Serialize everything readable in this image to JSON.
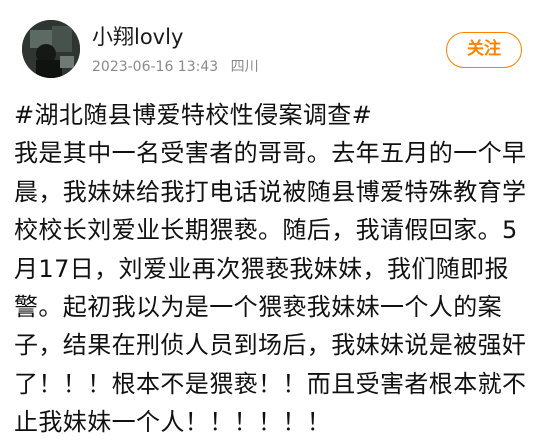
{
  "post": {
    "author": {
      "name": "小翔lovly",
      "timestamp": "2023-06-16 13:43",
      "location": "四川"
    },
    "follow_label": "关注",
    "hashtag": "#湖北随县博爱特校性侵案调查#",
    "lines": [
      "我是其中一名受害者的哥哥。去年五月的一个早",
      "晨，我妹妹给我打电话说被随县博爱特殊教育学",
      "校校长刘爱业长期猥亵。随后，我请假回家。5",
      "月17日，刘爱业再次猥亵我妹妹，我们随即报",
      "警。起初我以为是一个猥亵我妹妹一个人的案",
      "子，结果在刑侦人员到场后，我妹妹说是被强奸",
      "了！！！根本不是猥亵！！而且受害者根本就不",
      "止我妹妹一个人！！！！！！"
    ]
  },
  "colors": {
    "accent": "#ff8200",
    "meta_text": "#8a8a8a",
    "body_text": "#111111"
  }
}
